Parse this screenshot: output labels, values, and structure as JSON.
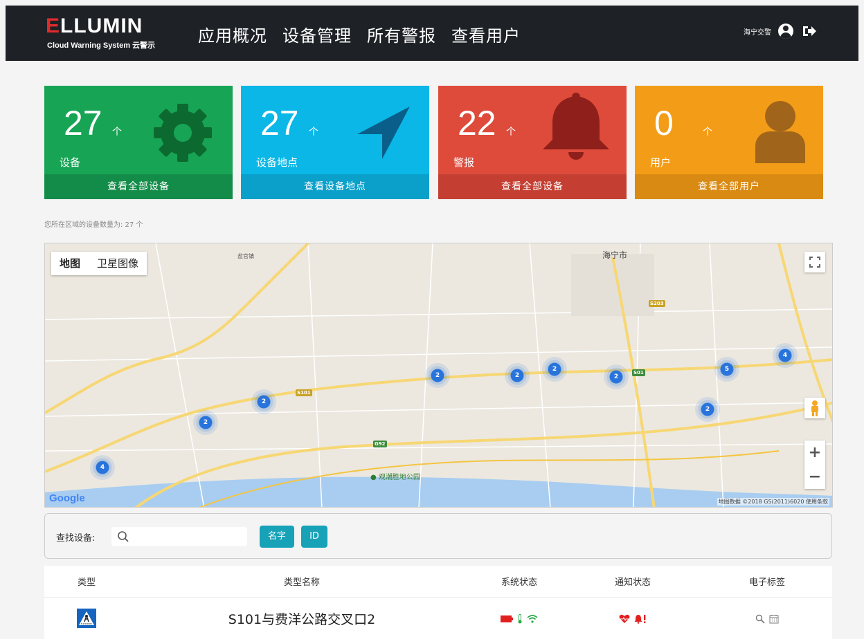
{
  "header": {
    "logo_text": "ELLUMIN",
    "logo_subtitle": "Cloud Warning System 云警示",
    "nav": [
      "应用概况",
      "设备管理",
      "所有警报",
      "查看用户"
    ],
    "user_name": "海宁交警"
  },
  "cards": [
    {
      "number": "27",
      "unit": "个",
      "label": "设备",
      "footer": "查看全部设备",
      "color": "#18a455",
      "footer_color": "#148c49",
      "icon": "gear-icon"
    },
    {
      "number": "27",
      "unit": "个",
      "label": "设备地点",
      "footer": "查看设备地点",
      "color": "#0ab7e6",
      "footer_color": "#0aa0ca",
      "icon": "location-arrow-icon"
    },
    {
      "number": "22",
      "unit": "个",
      "label": "警报",
      "footer": "查看全部设备",
      "color": "#de4b3b",
      "footer_color": "#c43f31",
      "icon": "bell-icon"
    },
    {
      "number": "0",
      "unit": "个",
      "label": "用户",
      "footer": "查看全部用户",
      "color": "#f39c17",
      "footer_color": "#d98a12",
      "icon": "user-icon"
    }
  ],
  "device_count_text": "您所在区域的设备数量为: 27 个",
  "map": {
    "type_buttons": [
      "地图",
      "卫星图像"
    ],
    "clusters": [
      "2",
      "2",
      "2",
      "2",
      "5",
      "4",
      "2",
      "2",
      "2",
      "2",
      "4"
    ],
    "labels": {
      "city": "海宁市",
      "yanguan": "盐官镇",
      "park": "观潮胜地公园",
      "credits": "地图数据 ©2018 GS(2011)6020  使用条款",
      "google": "Google"
    }
  },
  "search": {
    "label": "查找设备:",
    "placeholder": "",
    "buttons": [
      "名字",
      "ID"
    ]
  },
  "table": {
    "headers": [
      "类型",
      "类型名称",
      "系统状态",
      "通知状态",
      "电子标签"
    ],
    "rows": [
      {
        "name": "S101与费洋公路交叉口2"
      }
    ]
  }
}
